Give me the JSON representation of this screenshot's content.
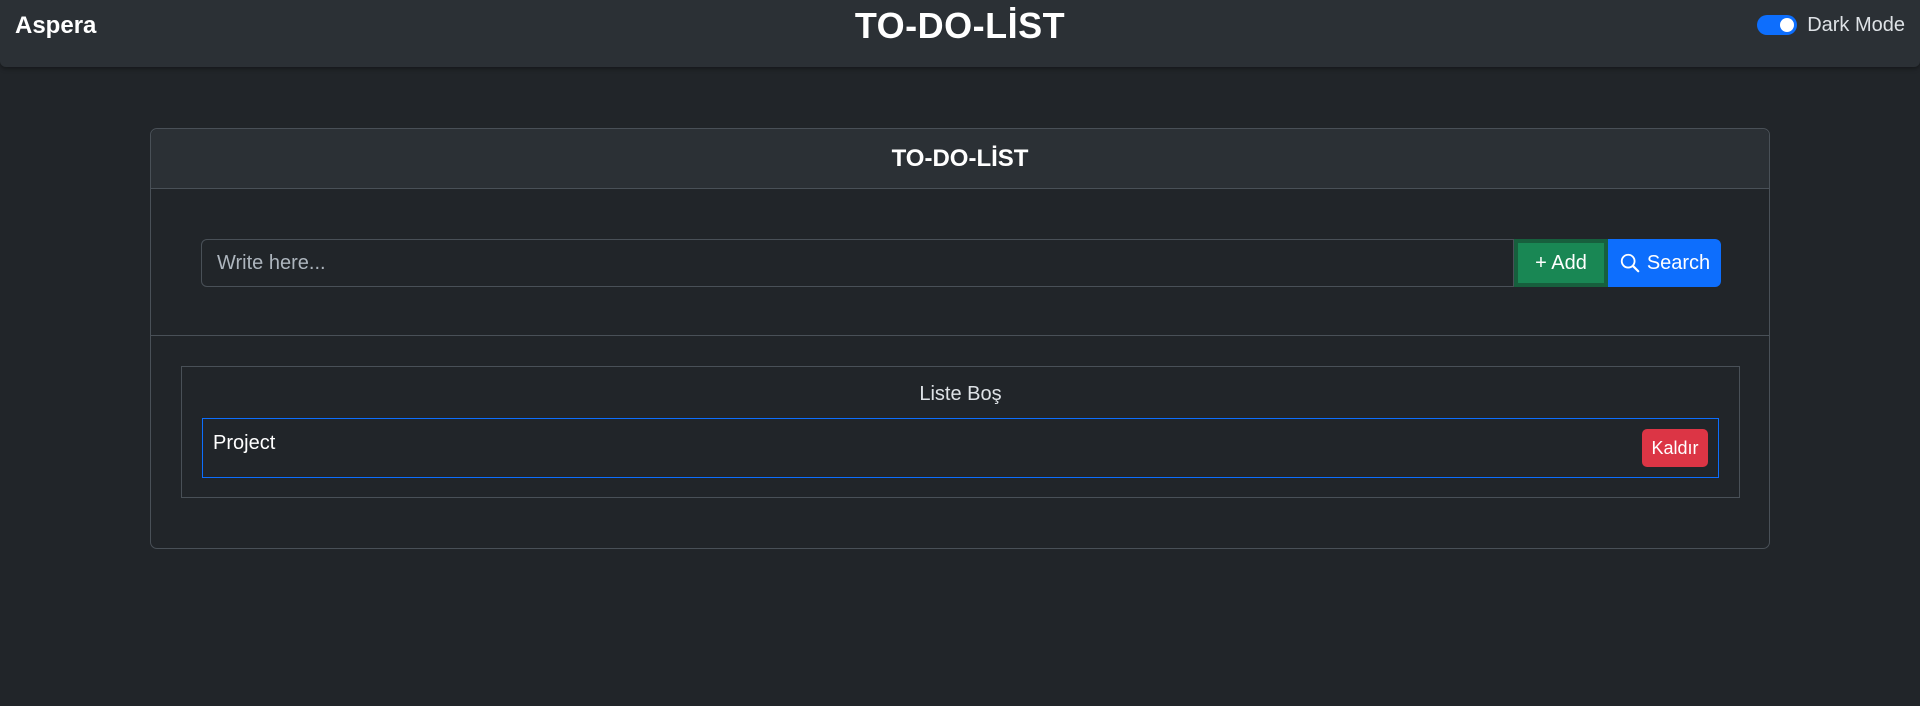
{
  "navbar": {
    "brand": "Aspera",
    "title": "TO-DO-LİST",
    "dark_mode": {
      "label": "Dark Mode",
      "enabled": true
    }
  },
  "card": {
    "header": "TO-DO-LİST",
    "input": {
      "placeholder": "Write here...",
      "value": ""
    },
    "add_button": "+ Add",
    "search_button": "Search",
    "list": {
      "status": "Liste Boş",
      "items": [
        {
          "text": "Project",
          "remove_label": "Kaldır"
        }
      ]
    }
  },
  "colors": {
    "background": "#212529",
    "navbar": "#2b3035",
    "primary": "#0d6efd",
    "success": "#198754",
    "danger": "#dc3545"
  },
  "icons": [
    "search-icon"
  ]
}
